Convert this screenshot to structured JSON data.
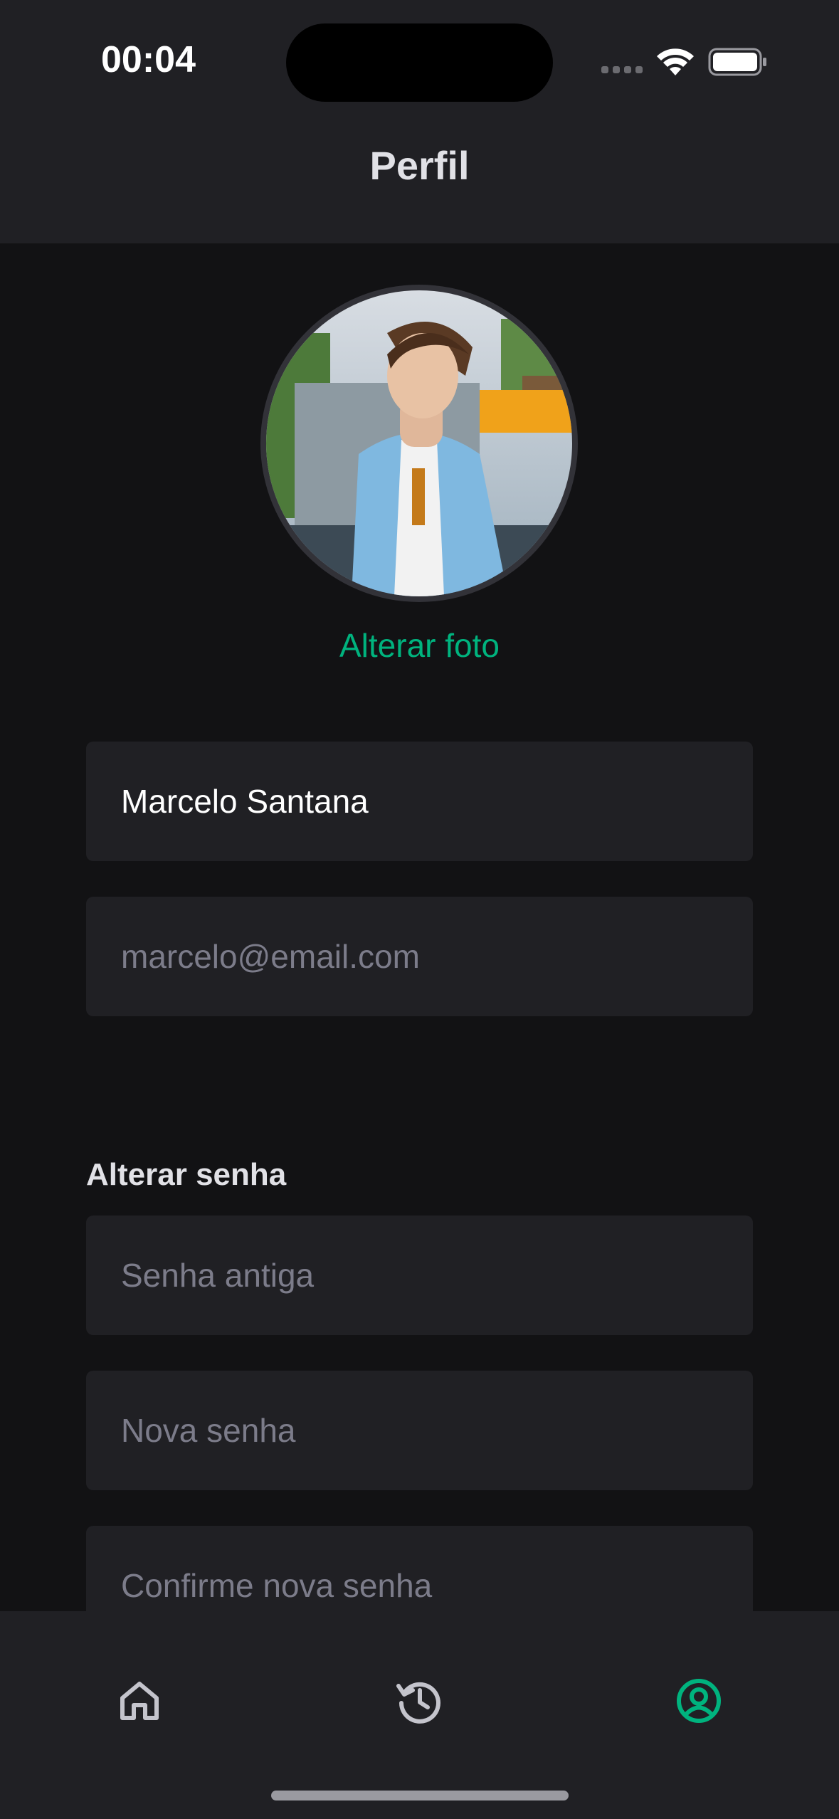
{
  "status_bar": {
    "time": "00:04",
    "icons": [
      "cellular-signal-icon",
      "wifi-icon",
      "battery-icon"
    ]
  },
  "header": {
    "title": "Perfil"
  },
  "profile": {
    "avatar": "profile-photo",
    "change_photo_label": "Alterar foto"
  },
  "form": {
    "name_value": "Marcelo Santana",
    "email_placeholder": "marcelo@email.com"
  },
  "password_section": {
    "title": "Alterar senha",
    "old_password_placeholder": "Senha antiga",
    "new_password_placeholder": "Nova senha",
    "confirm_password_placeholder": "Confirme nova senha"
  },
  "tab_bar": {
    "items": [
      {
        "icon": "home-icon",
        "active": false
      },
      {
        "icon": "history-icon",
        "active": false
      },
      {
        "icon": "user-circle-icon",
        "active": true
      }
    ]
  },
  "colors": {
    "accent": "#00b37e",
    "background": "#121214",
    "surface": "#202024",
    "placeholder": "#7c7c8a",
    "inactive_icon": "#c4c4cc"
  }
}
